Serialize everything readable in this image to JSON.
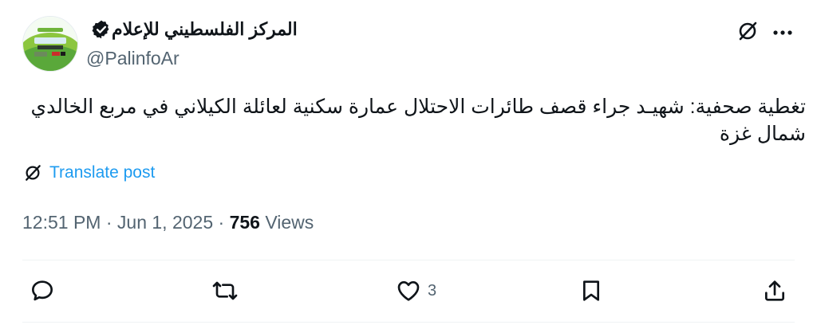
{
  "user": {
    "display_name": "المركز الفلسطيني للإعلام",
    "handle": "@PalinfoAr"
  },
  "tweet": {
    "text": "تغطية صحفية: شهيـد جراء قصف طائرات الاحتلال عمارة سكنية لعائلة الكيلاني في مربع الخالدي شمال غزة",
    "translate_label": "Translate post"
  },
  "meta": {
    "time": "12:51 PM",
    "separator": " · ",
    "date": "Jun 1, 2025",
    "views_count": "756",
    "views_label": " Views"
  },
  "actions": {
    "like_count": "3"
  },
  "icons": {
    "verified": "verified-badge-icon",
    "grok": "grok-icon",
    "more": "more-icon",
    "reply": "reply-icon",
    "retweet": "retweet-icon",
    "like": "heart-icon",
    "bookmark": "bookmark-icon",
    "share": "share-icon"
  },
  "colors": {
    "accent": "#1d9bf0",
    "secondary_text": "#536471",
    "primary_text": "#0f1419",
    "avatar_green": "#7cc242"
  }
}
